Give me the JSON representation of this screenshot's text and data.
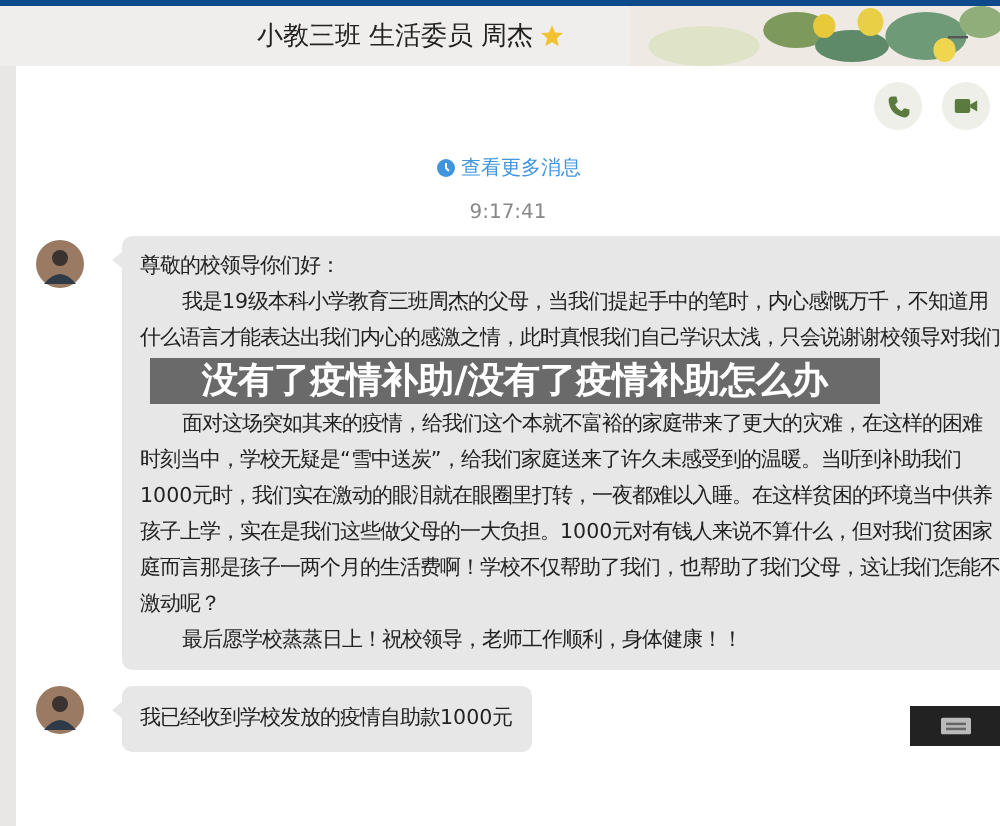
{
  "window": {
    "title": "小教三班 生活委员 周杰"
  },
  "chat": {
    "more_link": "查看更多消息",
    "timestamp": "9:17:41",
    "messages": [
      {
        "kind": "letter",
        "lines": [
          {
            "text": "尊敬的校领导你们好：",
            "indented": false
          },
          {
            "text": "我是19级本科小学教育三班周杰的父母，当我们提起手中的笔时，内心感慨万千，不知道用",
            "indented": true
          },
          {
            "text": "什么语言才能表达出我们内心的感激之情，此时真恨我们自己学识太浅，只会说谢谢校领导对我们",
            "indented": false
          },
          {
            "text": "面对这场突如其来的疫情，给我们这个本就不富裕的家庭带来了更大的灾难，在这样的困难",
            "indented": true
          },
          {
            "text": "时刻当中，学校无疑是“雪中送炭”，给我们家庭送来了许久未感受到的温暖。当听到补助我们",
            "indented": false
          },
          {
            "text": "1000元时，我们实在激动的眼泪就在眼圈里打转，一夜都难以入睡。在这样贫困的环境当中供养",
            "indented": false
          },
          {
            "text": "孩子上学，实在是我们这些做父母的一大负担。1000元对有钱人来说不算什么，但对我们贫困家",
            "indented": false
          },
          {
            "text": "庭而言那是孩子一两个月的生活费啊！学校不仅帮助了我们，也帮助了我们父母，这让我们怎能不",
            "indented": false
          },
          {
            "text": "激动呢？",
            "indented": false
          },
          {
            "text": "最后愿学校蒸蒸日上！祝校领导，老师工作顺利，身体健康！！",
            "indented": true
          }
        ]
      },
      {
        "kind": "text",
        "lines": [
          {
            "text": "我已经收到学校发放的疫情自助款1000元",
            "indented": false
          }
        ]
      }
    ]
  },
  "headline": "没有了疫情补助/没有了疫情补助怎么办"
}
